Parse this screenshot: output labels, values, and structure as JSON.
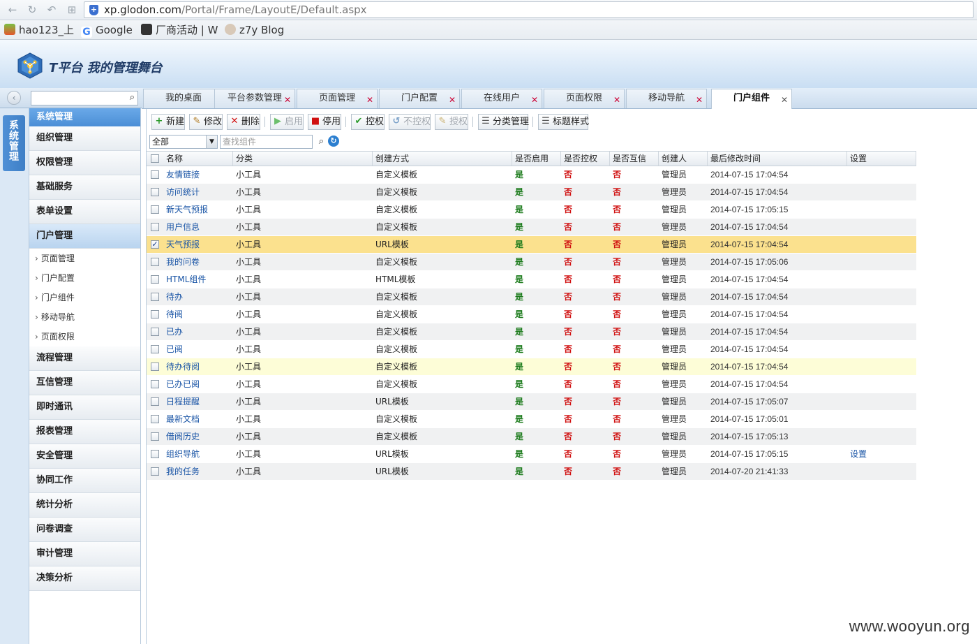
{
  "browser": {
    "url_host": "xp.glodon.com",
    "url_path": "/Portal/Frame/LayoutE/Default.aspx",
    "bookmarks": [
      "hao123_上",
      "Google",
      "厂商活动 | W",
      "z7y Blog"
    ]
  },
  "app": {
    "title": "T平台  我的管理舞台"
  },
  "sidebar": {
    "vertical_tab": "系统管理",
    "search_placeholder": "",
    "header": "系统管理",
    "items": [
      {
        "label": "组织管理"
      },
      {
        "label": "权限管理"
      },
      {
        "label": "基础服务"
      },
      {
        "label": "表单设置"
      },
      {
        "label": "门户管理",
        "active": true
      }
    ],
    "sub_items": [
      "页面管理",
      "门户配置",
      "门户组件",
      "移动导航",
      "页面权限"
    ],
    "items_after": [
      "流程管理",
      "互信管理",
      "即时通讯",
      "报表管理",
      "安全管理",
      "协同工作",
      "统计分析",
      "问卷调查",
      "审计管理",
      "决策分析"
    ]
  },
  "tabs": [
    "我的桌面",
    "平台参数管理",
    "页面管理",
    "门户配置",
    "在线用户",
    "页面权限",
    "移动导航",
    "门户组件"
  ],
  "active_tab": "门户组件",
  "toolbar": {
    "new": "新建",
    "edit": "修改",
    "delete": "删除",
    "enable": "启用",
    "disable": "停用",
    "control": "控权",
    "uncontrol": "不控权",
    "authorize": "授权",
    "category": "分类管理",
    "title_style": "标题样式"
  },
  "filter": {
    "category_value": "全部",
    "search_placeholder": "查找组件"
  },
  "grid": {
    "columns": [
      "名称",
      "分类",
      "创建方式",
      "是否启用",
      "是否控权",
      "是否互信",
      "创建人",
      "最后修改时间",
      "设置"
    ],
    "rows": [
      {
        "name": "友情链接",
        "category": "小工具",
        "method": "自定义模板",
        "enabled": "是",
        "controlled": "否",
        "trusted": "否",
        "creator": "管理员",
        "modified": "2014-07-15 17:04:54",
        "settings": ""
      },
      {
        "name": "访问统计",
        "category": "小工具",
        "method": "自定义模板",
        "enabled": "是",
        "controlled": "否",
        "trusted": "否",
        "creator": "管理员",
        "modified": "2014-07-15 17:04:54",
        "settings": ""
      },
      {
        "name": "新天气预报",
        "category": "小工具",
        "method": "自定义模板",
        "enabled": "是",
        "controlled": "否",
        "trusted": "否",
        "creator": "管理员",
        "modified": "2014-07-15 17:05:15",
        "settings": ""
      },
      {
        "name": "用户信息",
        "category": "小工具",
        "method": "自定义模板",
        "enabled": "是",
        "controlled": "否",
        "trusted": "否",
        "creator": "管理员",
        "modified": "2014-07-15 17:04:54",
        "settings": ""
      },
      {
        "name": "天气预报",
        "category": "小工具",
        "method": "URL模板",
        "enabled": "是",
        "controlled": "否",
        "trusted": "否",
        "creator": "管理员",
        "modified": "2014-07-15 17:04:54",
        "settings": "",
        "checked": true
      },
      {
        "name": "我的问卷",
        "category": "小工具",
        "method": "自定义模板",
        "enabled": "是",
        "controlled": "否",
        "trusted": "否",
        "creator": "管理员",
        "modified": "2014-07-15 17:05:06",
        "settings": ""
      },
      {
        "name": "HTML组件",
        "category": "小工具",
        "method": "HTML模板",
        "enabled": "是",
        "controlled": "否",
        "trusted": "否",
        "creator": "管理员",
        "modified": "2014-07-15 17:04:54",
        "settings": ""
      },
      {
        "name": "待办",
        "category": "小工具",
        "method": "自定义模板",
        "enabled": "是",
        "controlled": "否",
        "trusted": "否",
        "creator": "管理员",
        "modified": "2014-07-15 17:04:54",
        "settings": ""
      },
      {
        "name": "待阅",
        "category": "小工具",
        "method": "自定义模板",
        "enabled": "是",
        "controlled": "否",
        "trusted": "否",
        "creator": "管理员",
        "modified": "2014-07-15 17:04:54",
        "settings": ""
      },
      {
        "name": "已办",
        "category": "小工具",
        "method": "自定义模板",
        "enabled": "是",
        "controlled": "否",
        "trusted": "否",
        "creator": "管理员",
        "modified": "2014-07-15 17:04:54",
        "settings": ""
      },
      {
        "name": "已阅",
        "category": "小工具",
        "method": "自定义模板",
        "enabled": "是",
        "controlled": "否",
        "trusted": "否",
        "creator": "管理员",
        "modified": "2014-07-15 17:04:54",
        "settings": ""
      },
      {
        "name": "待办待阅",
        "category": "小工具",
        "method": "自定义模板",
        "enabled": "是",
        "controlled": "否",
        "trusted": "否",
        "creator": "管理员",
        "modified": "2014-07-15 17:04:54",
        "settings": "",
        "hover": true
      },
      {
        "name": "已办已阅",
        "category": "小工具",
        "method": "自定义模板",
        "enabled": "是",
        "controlled": "否",
        "trusted": "否",
        "creator": "管理员",
        "modified": "2014-07-15 17:04:54",
        "settings": ""
      },
      {
        "name": "日程提醒",
        "category": "小工具",
        "method": "URL模板",
        "enabled": "是",
        "controlled": "否",
        "trusted": "否",
        "creator": "管理员",
        "modified": "2014-07-15 17:05:07",
        "settings": ""
      },
      {
        "name": "最新文档",
        "category": "小工具",
        "method": "自定义模板",
        "enabled": "是",
        "controlled": "否",
        "trusted": "否",
        "creator": "管理员",
        "modified": "2014-07-15 17:05:01",
        "settings": ""
      },
      {
        "name": "借阅历史",
        "category": "小工具",
        "method": "自定义模板",
        "enabled": "是",
        "controlled": "否",
        "trusted": "否",
        "creator": "管理员",
        "modified": "2014-07-15 17:05:13",
        "settings": ""
      },
      {
        "name": "组织导航",
        "category": "小工具",
        "method": "URL模板",
        "enabled": "是",
        "controlled": "否",
        "trusted": "否",
        "creator": "管理员",
        "modified": "2014-07-15 17:05:15",
        "settings": "设置"
      },
      {
        "name": "我的任务",
        "category": "小工具",
        "method": "URL模板",
        "enabled": "是",
        "controlled": "否",
        "trusted": "否",
        "creator": "管理员",
        "modified": "2014-07-20 21:41:33",
        "settings": ""
      }
    ]
  },
  "watermark": "www.wooyun.org",
  "colors": {
    "accent": "#4b8ed6",
    "yes": "#1a7a1a",
    "no": "#d01010",
    "selected_row": "#fbe18e"
  }
}
